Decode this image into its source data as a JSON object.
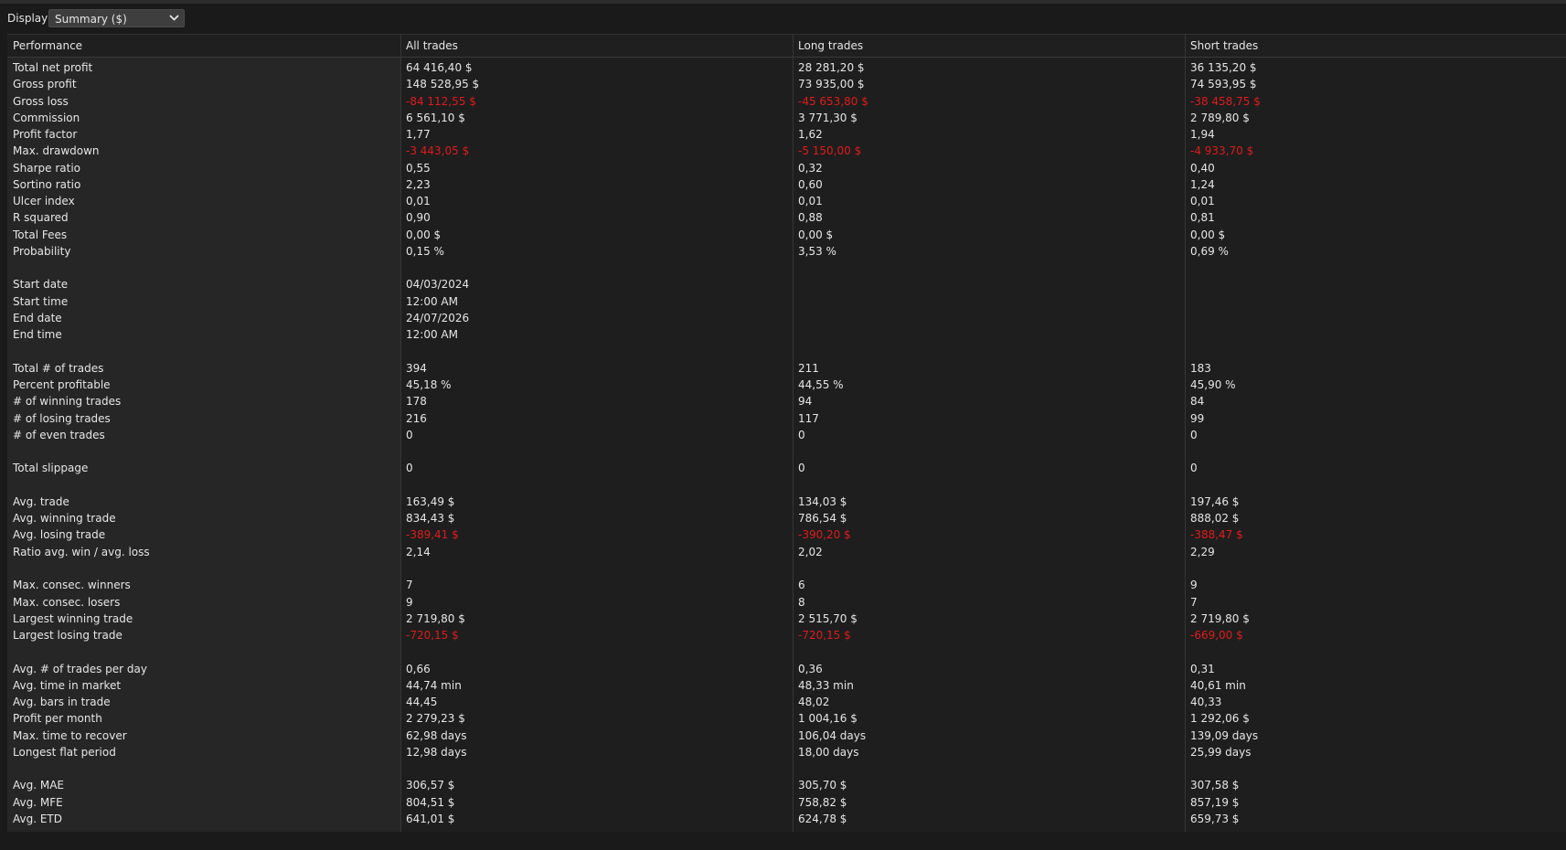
{
  "toolbar": {
    "display_label": "Display",
    "display_value": "Summary ($)"
  },
  "columns": [
    "Performance",
    "All trades",
    "Long trades",
    "Short trades"
  ],
  "colors": {
    "negative": "#e01b1b",
    "text": "#e6e6e6",
    "background": "#1e1e1e"
  },
  "rows": [
    {
      "label": "Total net profit",
      "values": [
        "64 416,40 $",
        "28 281,20 $",
        "36 135,20 $"
      ]
    },
    {
      "label": "Gross profit",
      "values": [
        "148 528,95 $",
        "73 935,00 $",
        "74 593,95 $"
      ]
    },
    {
      "label": "Gross loss",
      "values": [
        "-84 112,55 $",
        "-45 653,80 $",
        "-38 458,75 $"
      ],
      "negative": true
    },
    {
      "label": "Commission",
      "values": [
        "6 561,10 $",
        "3 771,30 $",
        "2 789,80 $"
      ]
    },
    {
      "label": "Profit factor",
      "values": [
        "1,77",
        "1,62",
        "1,94"
      ]
    },
    {
      "label": "Max. drawdown",
      "values": [
        "-3 443,05 $",
        "-5 150,00 $",
        "-4 933,70 $"
      ],
      "negative": true
    },
    {
      "label": "Sharpe ratio",
      "values": [
        "0,55",
        "0,32",
        "0,40"
      ]
    },
    {
      "label": "Sortino ratio",
      "values": [
        "2,23",
        "0,60",
        "1,24"
      ]
    },
    {
      "label": "Ulcer index",
      "values": [
        "0,01",
        "0,01",
        "0,01"
      ]
    },
    {
      "label": "R squared",
      "values": [
        "0,90",
        "0,88",
        "0,81"
      ]
    },
    {
      "label": "Total Fees",
      "values": [
        "0,00 $",
        "0,00 $",
        "0,00 $"
      ]
    },
    {
      "label": "Probability",
      "values": [
        "0,15 %",
        "3,53 %",
        "0,69 %"
      ]
    },
    {
      "label": "",
      "values": [
        "",
        "",
        ""
      ]
    },
    {
      "label": "Start date",
      "values": [
        "04/03/2024",
        "",
        ""
      ]
    },
    {
      "label": "Start time",
      "values": [
        "12:00 AM",
        "",
        ""
      ]
    },
    {
      "label": "End date",
      "values": [
        "24/07/2026",
        "",
        ""
      ]
    },
    {
      "label": "End time",
      "values": [
        "12:00 AM",
        "",
        ""
      ]
    },
    {
      "label": "",
      "values": [
        "",
        "",
        ""
      ]
    },
    {
      "label": "Total # of trades",
      "values": [
        "394",
        "211",
        "183"
      ]
    },
    {
      "label": "Percent profitable",
      "values": [
        "45,18 %",
        "44,55 %",
        "45,90 %"
      ]
    },
    {
      "label": "# of winning trades",
      "values": [
        "178",
        "94",
        "84"
      ]
    },
    {
      "label": "# of losing trades",
      "values": [
        "216",
        "117",
        "99"
      ]
    },
    {
      "label": "# of even trades",
      "values": [
        "0",
        "0",
        "0"
      ]
    },
    {
      "label": "",
      "values": [
        "",
        "",
        ""
      ]
    },
    {
      "label": "Total slippage",
      "values": [
        "0",
        "0",
        "0"
      ]
    },
    {
      "label": "",
      "values": [
        "",
        "",
        ""
      ]
    },
    {
      "label": "Avg. trade",
      "values": [
        "163,49 $",
        "134,03 $",
        "197,46 $"
      ]
    },
    {
      "label": "Avg. winning trade",
      "values": [
        "834,43 $",
        "786,54 $",
        "888,02 $"
      ]
    },
    {
      "label": "Avg. losing trade",
      "values": [
        "-389,41 $",
        "-390,20 $",
        "-388,47 $"
      ],
      "negative": true
    },
    {
      "label": "Ratio avg. win / avg. loss",
      "values": [
        "2,14",
        "2,02",
        "2,29"
      ]
    },
    {
      "label": "",
      "values": [
        "",
        "",
        ""
      ]
    },
    {
      "label": "Max. consec. winners",
      "values": [
        "7",
        "6",
        "9"
      ]
    },
    {
      "label": "Max. consec. losers",
      "values": [
        "9",
        "8",
        "7"
      ]
    },
    {
      "label": "Largest winning trade",
      "values": [
        "2 719,80 $",
        "2 515,70 $",
        "2 719,80 $"
      ]
    },
    {
      "label": "Largest losing trade",
      "values": [
        "-720,15 $",
        "-720,15 $",
        "-669,00 $"
      ],
      "negative": true
    },
    {
      "label": "",
      "values": [
        "",
        "",
        ""
      ]
    },
    {
      "label": "Avg. # of trades per day",
      "values": [
        "0,66",
        "0,36",
        "0,31"
      ]
    },
    {
      "label": "Avg. time in market",
      "values": [
        "44,74 min",
        "48,33 min",
        "40,61 min"
      ]
    },
    {
      "label": "Avg. bars in trade",
      "values": [
        "44,45",
        "48,02",
        "40,33"
      ]
    },
    {
      "label": "Profit per month",
      "values": [
        "2 279,23 $",
        "1 004,16 $",
        "1 292,06 $"
      ]
    },
    {
      "label": "Max. time to recover",
      "values": [
        "62,98 days",
        "106,04 days",
        "139,09 days"
      ]
    },
    {
      "label": "Longest flat period",
      "values": [
        "12,98 days",
        "18,00 days",
        "25,99 days"
      ]
    },
    {
      "label": "",
      "values": [
        "",
        "",
        ""
      ]
    },
    {
      "label": "Avg. MAE",
      "values": [
        "306,57 $",
        "305,70 $",
        "307,58 $"
      ]
    },
    {
      "label": "Avg. MFE",
      "values": [
        "804,51 $",
        "758,82 $",
        "857,19 $"
      ]
    },
    {
      "label": "Avg. ETD",
      "values": [
        "641,01 $",
        "624,78 $",
        "659,73 $"
      ]
    }
  ]
}
